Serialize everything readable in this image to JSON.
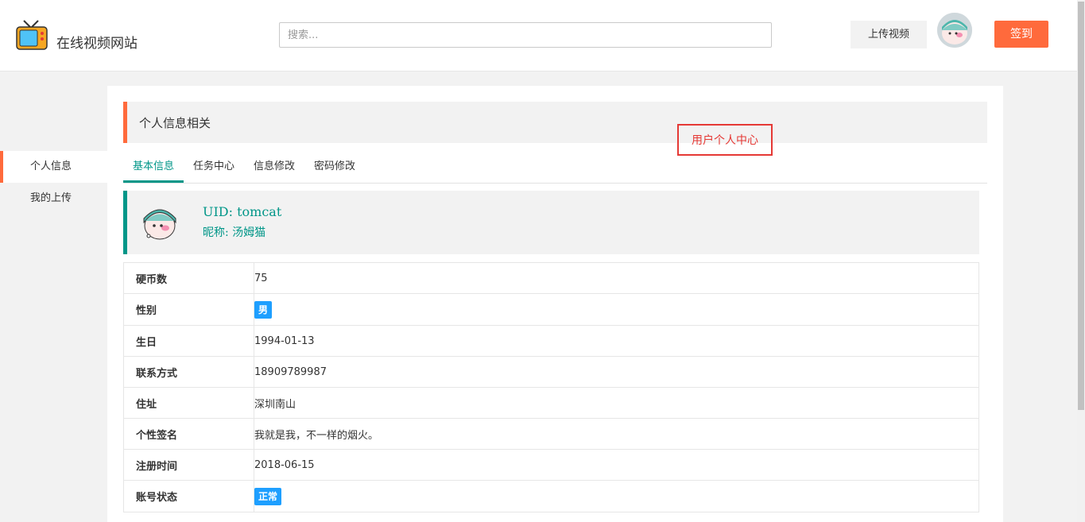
{
  "header": {
    "site_title": "在线视频网站",
    "search_placeholder": "搜索...",
    "upload_label": "上传视频",
    "signin_label": "签到"
  },
  "sidebar": {
    "items": [
      {
        "label": "个人信息",
        "active": true
      },
      {
        "label": "我的上传",
        "active": false
      }
    ]
  },
  "main": {
    "section_title": "个人信息相关",
    "annotation": "用户个人中心",
    "tabs": [
      {
        "label": "基本信息",
        "active": true
      },
      {
        "label": "任务中心",
        "active": false
      },
      {
        "label": "信息修改",
        "active": false
      },
      {
        "label": "密码修改",
        "active": false
      }
    ],
    "profile": {
      "uid": "UID: tomcat",
      "nickname": "昵称: 汤姆猫"
    },
    "info_rows": [
      {
        "key": "硬币数",
        "value": "75"
      },
      {
        "key": "性别",
        "value": "男"
      },
      {
        "key": "生日",
        "value": "1994-01-13"
      },
      {
        "key": "联系方式",
        "value": "18909789987"
      },
      {
        "key": "住址",
        "value": "深圳南山"
      },
      {
        "key": "个性签名",
        "value": "我就是我，不一样的烟火。"
      },
      {
        "key": "注册时间",
        "value": "2018-06-15"
      },
      {
        "key": "账号状态",
        "value": "正常"
      }
    ]
  },
  "colors": {
    "accent": "#ff6a3c",
    "teal": "#009688",
    "badge_blue": "#1e9fff",
    "annotation_red": "#e53935"
  }
}
